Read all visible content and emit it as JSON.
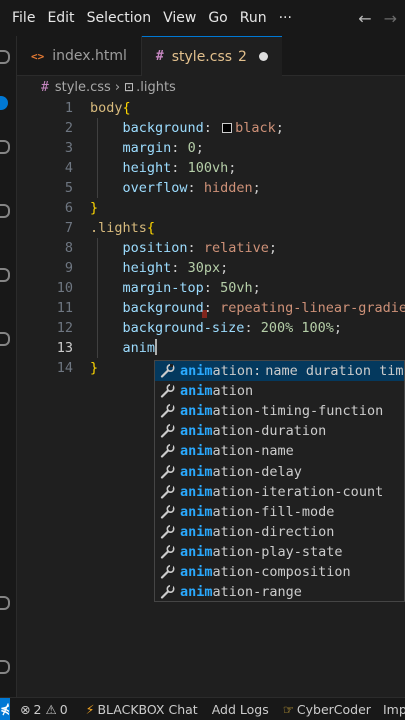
{
  "menu": {
    "items": [
      "File",
      "Edit",
      "Selection",
      "View",
      "Go",
      "Run"
    ],
    "more": "···"
  },
  "tabs": [
    {
      "icon": "<>",
      "label": "index.html"
    },
    {
      "icon": "#",
      "label": "style.css",
      "problems": "2"
    }
  ],
  "breadcrumb": {
    "file": "style.css",
    "symbol": ".lights"
  },
  "editor": {
    "lines": [
      {
        "n": "1",
        "parts": [
          [
            "sel",
            "body"
          ],
          [
            "brace",
            "{"
          ]
        ]
      },
      {
        "n": "2",
        "parts": [
          [
            "txt",
            "    "
          ],
          [
            "prop",
            "background"
          ],
          [
            "txt",
            ": "
          ],
          [
            "swatch",
            ""
          ],
          [
            "val",
            "black"
          ],
          [
            "txt",
            ";"
          ]
        ]
      },
      {
        "n": "3",
        "parts": [
          [
            "txt",
            "    "
          ],
          [
            "prop",
            "margin"
          ],
          [
            "txt",
            ": "
          ],
          [
            "num",
            "0"
          ],
          [
            "txt",
            ";"
          ]
        ]
      },
      {
        "n": "4",
        "parts": [
          [
            "txt",
            "    "
          ],
          [
            "prop",
            "height"
          ],
          [
            "txt",
            ": "
          ],
          [
            "num",
            "100vh"
          ],
          [
            "txt",
            ";"
          ]
        ]
      },
      {
        "n": "5",
        "parts": [
          [
            "txt",
            "    "
          ],
          [
            "prop",
            "overflow"
          ],
          [
            "txt",
            ": "
          ],
          [
            "val",
            "hidden"
          ],
          [
            "txt",
            ";"
          ]
        ]
      },
      {
        "n": "6",
        "parts": [
          [
            "brace",
            "}"
          ]
        ]
      },
      {
        "n": "7",
        "parts": [
          [
            "sel",
            ".lights"
          ],
          [
            "brace",
            "{"
          ]
        ]
      },
      {
        "n": "8",
        "parts": [
          [
            "txt",
            "    "
          ],
          [
            "prop",
            "position"
          ],
          [
            "txt",
            ": "
          ],
          [
            "val",
            "relative"
          ],
          [
            "txt",
            ";"
          ]
        ]
      },
      {
        "n": "9",
        "parts": [
          [
            "txt",
            "    "
          ],
          [
            "prop",
            "height"
          ],
          [
            "txt",
            ": "
          ],
          [
            "num",
            "30px"
          ],
          [
            "txt",
            ";"
          ]
        ]
      },
      {
        "n": "10",
        "parts": [
          [
            "txt",
            "    "
          ],
          [
            "prop",
            "margin-top"
          ],
          [
            "txt",
            ": "
          ],
          [
            "num",
            "50vh"
          ],
          [
            "txt",
            ";"
          ]
        ]
      },
      {
        "n": "11",
        "parts": [
          [
            "txt",
            "    "
          ],
          [
            "prop",
            "background"
          ],
          [
            "txt",
            ": "
          ],
          [
            "val",
            "repeating-linear-gradie"
          ]
        ]
      },
      {
        "n": "12",
        "parts": [
          [
            "txt",
            "    "
          ],
          [
            "prop",
            "background-size"
          ],
          [
            "txt",
            ": "
          ],
          [
            "num",
            "200%"
          ],
          [
            "txt",
            " "
          ],
          [
            "num",
            "100%"
          ],
          [
            "txt",
            ";"
          ]
        ]
      },
      {
        "n": "13",
        "parts": [
          [
            "txt",
            "    "
          ],
          [
            "prop",
            "anim"
          ],
          [
            "cursor",
            ""
          ]
        ]
      },
      {
        "n": "14",
        "parts": [
          [
            "brace",
            "}"
          ]
        ]
      }
    ],
    "current_line": "13"
  },
  "suggest": {
    "typed": "anim",
    "items": [
      {
        "rest": "ation:",
        "detail": "name duration tim"
      },
      {
        "rest": "ation"
      },
      {
        "rest": "ation-timing-function"
      },
      {
        "rest": "ation-duration"
      },
      {
        "rest": "ation-name"
      },
      {
        "rest": "ation-delay"
      },
      {
        "rest": "ation-iteration-count"
      },
      {
        "rest": "ation-fill-mode"
      },
      {
        "rest": "ation-direction"
      },
      {
        "rest": "ation-play-state"
      },
      {
        "rest": "ation-composition"
      },
      {
        "rest": "ation-range"
      }
    ]
  },
  "status": {
    "errors": "2",
    "warnings": "0",
    "blackbox": "BLACKBOX Chat",
    "add_logs": "Add Logs",
    "cybercoder": "CyberCoder",
    "truncated": "Imp"
  },
  "colors": {
    "accent": "#0078d4",
    "suggest_focus": "#04395e",
    "match_highlight": "#2aaaff",
    "modified_tab": "#e2c08d"
  }
}
